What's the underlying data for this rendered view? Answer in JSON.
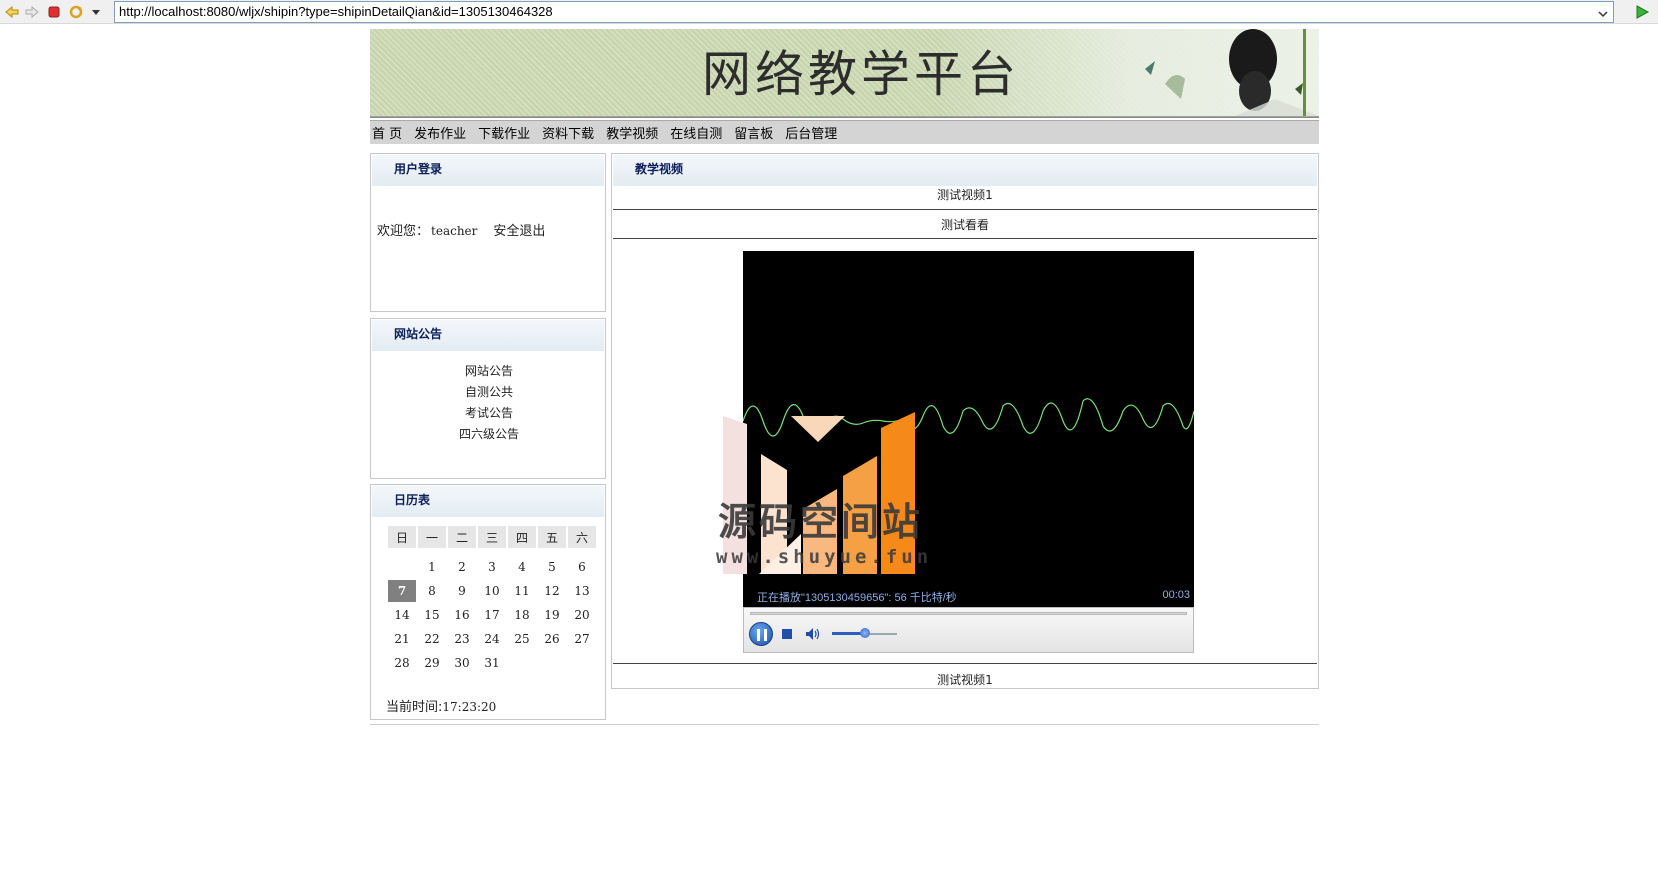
{
  "browser": {
    "url": "http://localhost:8080/wljx/shipin?type=shipinDetailQian&id=1305130464328",
    "icons": [
      "back-icon",
      "forward-icon",
      "stop-icon",
      "refresh-icon",
      "dropdown-icon",
      "go-icon"
    ]
  },
  "banner": {
    "title": "网络教学平台"
  },
  "nav": {
    "items": [
      {
        "label": "首 页"
      },
      {
        "label": "发布作业"
      },
      {
        "label": "下载作业"
      },
      {
        "label": "资料下载"
      },
      {
        "label": "教学视频"
      },
      {
        "label": "在线自测"
      },
      {
        "label": "留言板"
      },
      {
        "label": "后台管理"
      }
    ]
  },
  "login": {
    "title": "用户登录",
    "welcome": "欢迎您：",
    "username": "teacher",
    "logout": "安全退出"
  },
  "notices": {
    "title": "网站公告",
    "items": [
      "网站公告",
      "自测公共",
      "考试公告",
      "四六级公告"
    ]
  },
  "calendar": {
    "title": "日历表",
    "weekdays": [
      "日",
      "一",
      "二",
      "三",
      "四",
      "五",
      "六"
    ],
    "weeks": [
      [
        "",
        "1",
        "2",
        "3",
        "4",
        "5",
        "6"
      ],
      [
        "7",
        "8",
        "9",
        "10",
        "11",
        "12",
        "13"
      ],
      [
        "14",
        "15",
        "16",
        "17",
        "18",
        "19",
        "20"
      ],
      [
        "21",
        "22",
        "23",
        "24",
        "25",
        "26",
        "27"
      ],
      [
        "28",
        "29",
        "30",
        "31",
        "",
        "",
        ""
      ]
    ],
    "today": "7",
    "now_label": "当前时间:",
    "now_value": "17:23:20"
  },
  "video": {
    "title": "教学视频",
    "name": "测试视频1",
    "description": "测试看看",
    "footer_name": "测试视频1",
    "player": {
      "status": "正在播放\"1305130459656\": 56 千比特/秒",
      "time": "00:03",
      "volume": 0.5
    }
  },
  "watermark": {
    "text": "源码空间站",
    "url": "www.shuyue.fun"
  }
}
